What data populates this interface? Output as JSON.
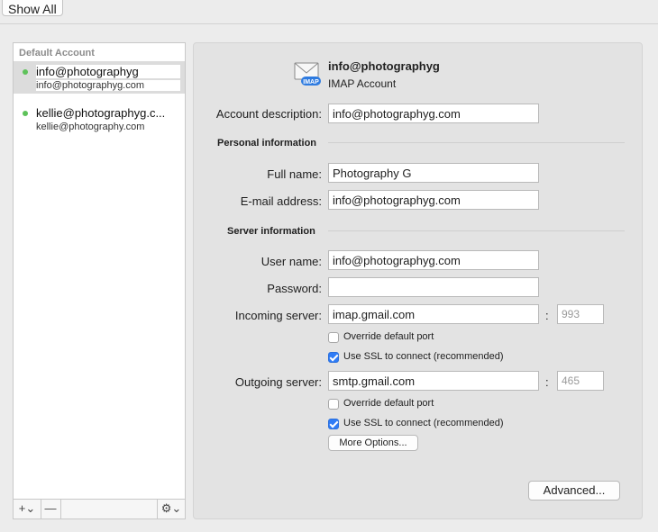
{
  "toolbar": {
    "show_all": "Show All"
  },
  "sidebar": {
    "header": "Default Account",
    "accounts": [
      {
        "name": "info@photographyg",
        "email": "info@photographyg.com"
      },
      {
        "name": "kellie@photographyg.c...",
        "email": "kellie@photography.com"
      }
    ],
    "add_label": "+⌄",
    "remove_label": "—",
    "gear_label": "⚙⌄"
  },
  "account": {
    "display_name": "info@photographyg",
    "type_label": "IMAP Account",
    "icon_badge": "IMAP"
  },
  "form": {
    "description_label": "Account description:",
    "description_value": "info@photographyg.com",
    "personal_section": "Personal information",
    "full_name_label": "Full name:",
    "full_name_value": "Photography G",
    "email_label": "E-mail address:",
    "email_value": "info@photographyg.com",
    "server_section": "Server information",
    "username_label": "User name:",
    "username_value": "info@photographyg.com",
    "password_label": "Password:",
    "password_value": "",
    "incoming_label": "Incoming server:",
    "incoming_value": "imap.gmail.com",
    "incoming_port": "993",
    "incoming_override_label": "Override default port",
    "incoming_ssl_label": "Use SSL to connect (recommended)",
    "outgoing_label": "Outgoing server:",
    "outgoing_value": "smtp.gmail.com",
    "outgoing_port": "465",
    "outgoing_override_label": "Override default port",
    "outgoing_ssl_label": "Use SSL to connect (recommended)",
    "colon": ":",
    "more_options": "More Options...",
    "advanced": "Advanced..."
  },
  "states": {
    "incoming_override": false,
    "incoming_ssl": true,
    "outgoing_override": false,
    "outgoing_ssl": true
  },
  "colors": {
    "status_online": "#5ec25a",
    "checkbox_accent": "#2f7cf6"
  },
  "icons": [
    "envelope-icon",
    "plus-icon",
    "minus-icon",
    "gear-icon",
    "checkbox-checked-icon"
  ]
}
